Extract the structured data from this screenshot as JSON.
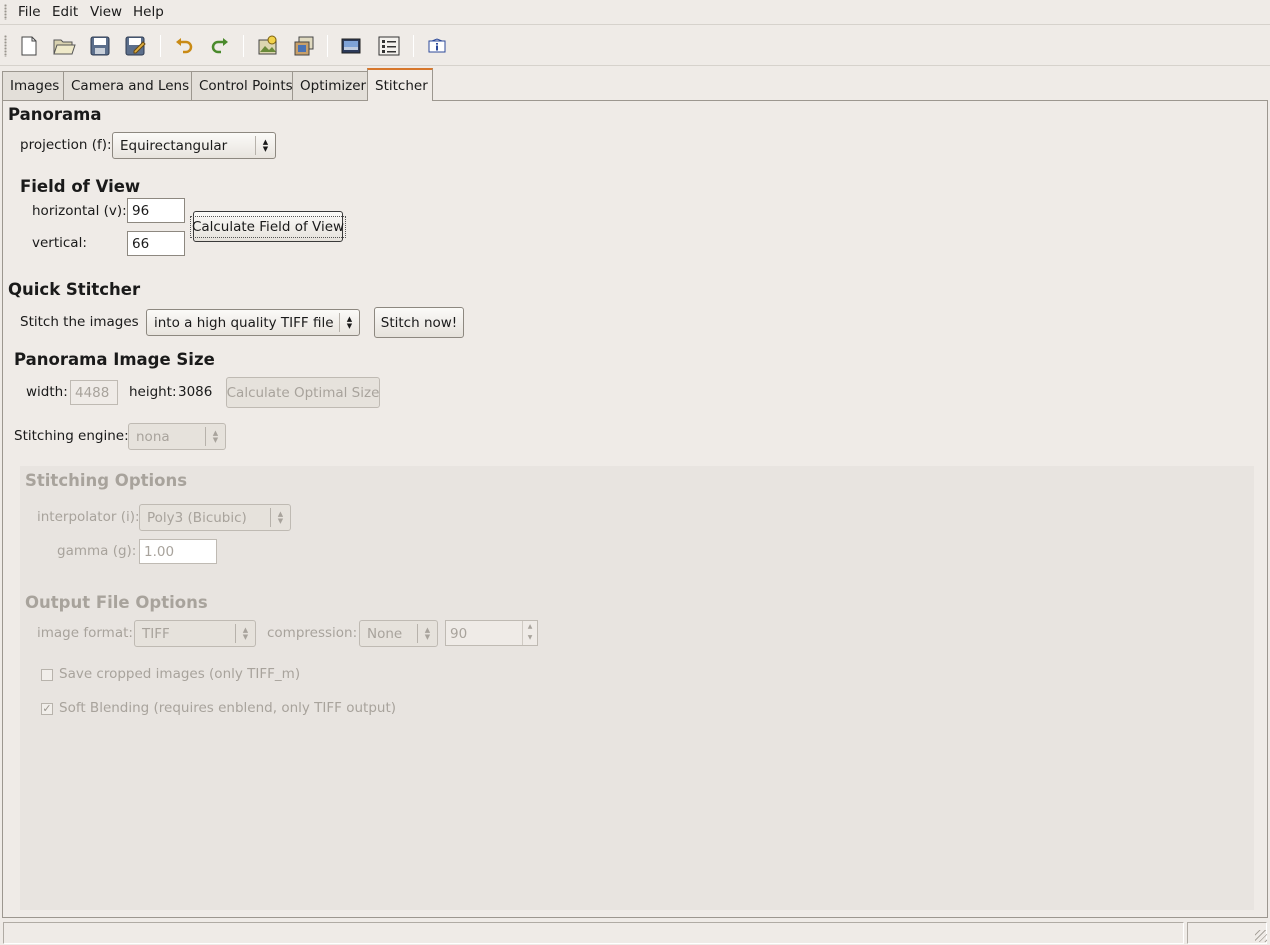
{
  "menu": {
    "file": "File",
    "edit": "Edit",
    "view": "View",
    "help": "Help"
  },
  "toolbar": {
    "buttons": [
      "new-file-icon",
      "open-folder-icon",
      "save-icon",
      "save-as-icon",
      "undo-icon",
      "redo-icon",
      "add-image-icon",
      "add-series-icon",
      "preview-icon",
      "panorama-settings-icon",
      "about-icon"
    ]
  },
  "tabs": {
    "images": "Images",
    "camera_lens": "Camera and Lens",
    "control_points": "Control Points",
    "optimizer": "Optimizer",
    "stitcher": "Stitcher"
  },
  "panorama": {
    "heading": "Panorama",
    "projection_label": "projection (f):",
    "projection_value": "Equirectangular"
  },
  "fov": {
    "heading": "Field of View",
    "horizontal_label": "horizontal (v):",
    "horizontal_value": "96",
    "vertical_label": "vertical:",
    "vertical_value": "66",
    "calc_button": "Calculate Field of View"
  },
  "quick_stitcher": {
    "heading": "Quick Stitcher",
    "stitch_label": "Stitch the images",
    "stitch_value": "into a high quality TIFF file",
    "stitch_button": "Stitch now!"
  },
  "image_size": {
    "heading": "Panorama Image Size",
    "width_label": "width:",
    "width_value": "4488",
    "height_label": "height:",
    "height_value": "3086",
    "calc_button": "Calculate Optimal Size"
  },
  "engine": {
    "label": "Stitching engine:",
    "value": "nona"
  },
  "stitching_options": {
    "heading": "Stitching Options",
    "interpolator_label": "interpolator (i):",
    "interpolator_value": "Poly3 (Bicubic)",
    "gamma_label": "gamma (g):",
    "gamma_value": "1.00"
  },
  "output_options": {
    "heading": "Output File Options",
    "format_label": "image format:",
    "format_value": "TIFF",
    "compression_label": "compression:",
    "compression_value": "None",
    "quality_value": "90",
    "save_cropped_label": "Save cropped images (only TIFF_m)",
    "save_cropped_checked": false,
    "soft_blending_label": "Soft Blending (requires enblend, only TIFF output)",
    "soft_blending_checked": true
  }
}
